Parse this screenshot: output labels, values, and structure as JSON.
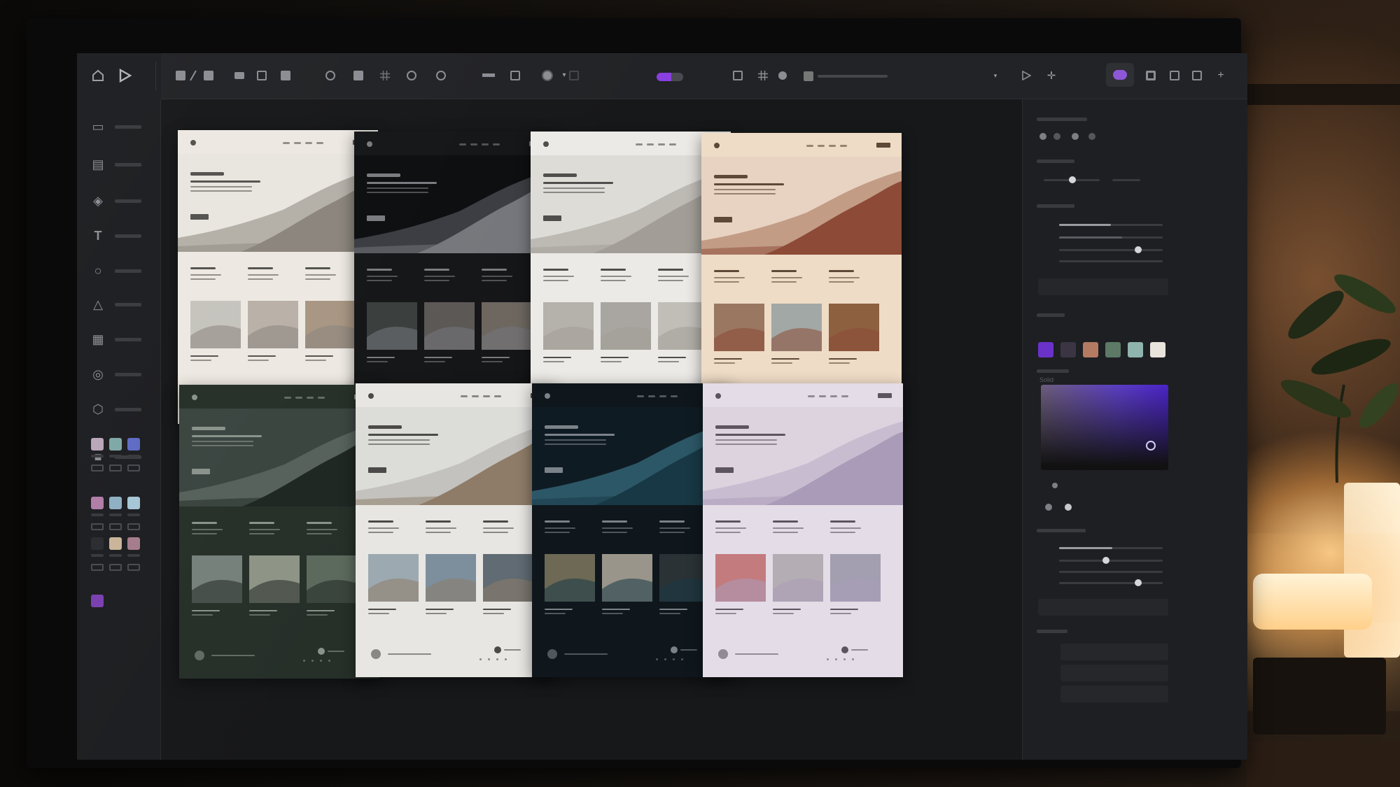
{
  "app": {
    "accent": "#8e57d8"
  },
  "toolbar": {
    "left_icons": [
      "home-icon",
      "play-logo-icon"
    ],
    "tools": [
      "rect-fill-icon",
      "pen-icon",
      "rect-icon",
      "rect-small-icon",
      "square-outline-icon",
      "square-fill-icon",
      "circle-target-icon",
      "square-solid-icon",
      "grid-icon",
      "radial-icon",
      "compass-icon",
      "minus-bar-icon",
      "close-box-icon",
      "circle-fill-icon",
      "chevron-down-icon",
      "color-toggle"
    ],
    "right_icons": [
      "square-icon",
      "grid-icon",
      "dot-icon",
      "play-icon",
      "move-icon"
    ],
    "mode_icons": [
      "mode-pill-icon",
      "frame-icon",
      "square-icon",
      "square-outline-icon",
      "plus-icon"
    ]
  },
  "sidebar": {
    "items": [
      "image-icon",
      "layout-icon",
      "layers-icon",
      "text-icon",
      "circle-icon",
      "triangle-icon",
      "table-icon",
      "component-icon",
      "hexagon-icon",
      "block-icon"
    ],
    "swatches": [
      "#b9a6b8",
      "#7fa7a6",
      "#5e6bc4",
      "#b07da6",
      "#8fb0c3",
      "#a6c5d6",
      "#2b2c30",
      "#c9b49a",
      "#a47c8c",
      "#7b3fb0"
    ]
  },
  "panel": {
    "swatches": [
      "#6a32c9",
      "#3b3543",
      "#b57a62",
      "#5c7a66",
      "#8fb4ad",
      "#e8e4dc"
    ],
    "picker": {
      "hue": "#5b3ec2"
    },
    "label": "Solid"
  },
  "cards": [
    {
      "theme": "light-mountain",
      "bg": "#ede9e2",
      "ink": "#55534f",
      "hero_bg": "#e9e6e0",
      "hero_mtn": "#b4b0a8",
      "hero_mtn2": "#8b857d",
      "thumbs": [
        "#c6c3bd",
        "#b9b0a7",
        "#a89683"
      ]
    },
    {
      "theme": "dark-mountain",
      "bg": "#151618",
      "ink": "#7a7b7e",
      "hero_bg": "#0d0e10",
      "hero_mtn": "#3b3d42",
      "hero_mtn2": "#75777c",
      "thumbs": [
        "#3a3f3d",
        "#5b5856",
        "#6d6760"
      ]
    },
    {
      "theme": "mist-mountain",
      "bg": "#eceae6",
      "ink": "#4f4e4c",
      "hero_bg": "#dedcd7",
      "hero_mtn": "#bdbab4",
      "hero_mtn2": "#a29e97",
      "thumbs": [
        "#b5b2ac",
        "#a9a6a1",
        "#c1beb8"
      ]
    },
    {
      "theme": "desert-mountain",
      "bg": "#efdcc6",
      "ink": "#5e4838",
      "hero_bg": "#e8d3c2",
      "hero_mtn": "#c39c86",
      "hero_mtn2": "#8c4a37",
      "thumbs": [
        "#9a7761",
        "#a2a8a6",
        "#8d6040"
      ]
    },
    {
      "theme": "forest-mountain",
      "bg": "#263029",
      "ink": "#8a938b",
      "hero_bg": "#3a4540",
      "hero_mtn": "#55615a",
      "hero_mtn2": "#1f2723",
      "thumbs": [
        "#75807a",
        "#8e9486",
        "#5c6a5d"
      ]
    },
    {
      "theme": "coast-mountain",
      "bg": "#e8e6e2",
      "ink": "#4b4a48",
      "hero_bg": "#dcdcd9",
      "hero_mtn": "#c3c2be",
      "hero_mtn2": "#8e7c68",
      "thumbs": [
        "#9da9b0",
        "#7d8f9d",
        "#606b73"
      ]
    },
    {
      "theme": "ocean-night",
      "bg": "#0f171d",
      "ink": "#7b8389",
      "hero_bg": "#0f1b23",
      "hero_mtn": "#2c5766",
      "hero_mtn2": "#183845",
      "thumbs": [
        "#6d6955",
        "#9a958a",
        "#2a3236"
      ]
    },
    {
      "theme": "lavender-snow",
      "bg": "#e4dce6",
      "ink": "#5c5560",
      "hero_bg": "#ddd3df",
      "hero_mtn": "#c8bdd0",
      "hero_mtn2": "#aa9cb8",
      "thumbs": [
        "#c47b7e",
        "#b4adb4",
        "#a39fb1"
      ]
    }
  ]
}
